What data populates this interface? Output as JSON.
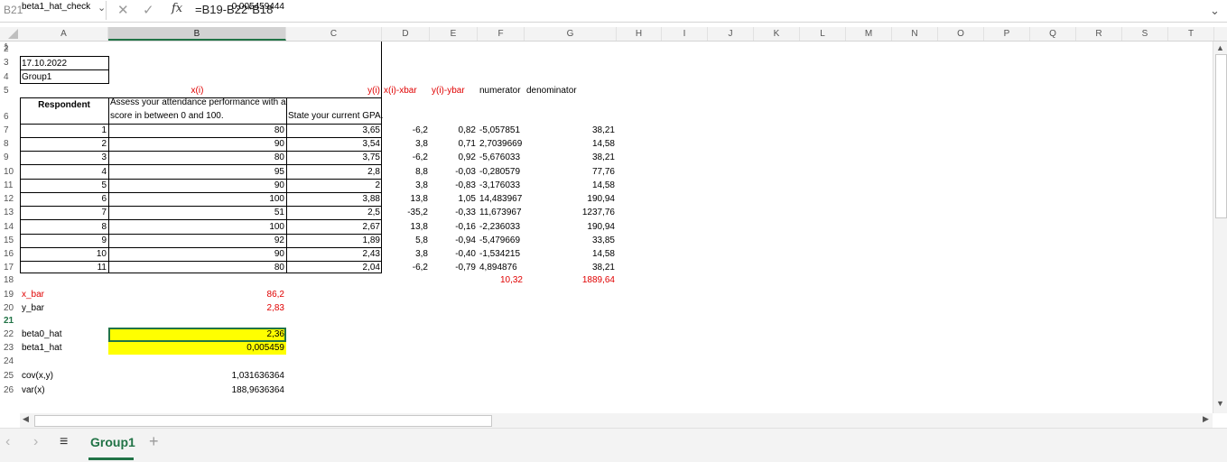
{
  "formula_bar": {
    "name_box": "B21",
    "fx_label": "fx",
    "formula": "=B19-B22*B18"
  },
  "columns": [
    "A",
    "B",
    "C",
    "D",
    "E",
    "F",
    "G",
    "H",
    "I",
    "J",
    "K",
    "L",
    "M",
    "N",
    "O",
    "P",
    "Q",
    "R",
    "S",
    "T"
  ],
  "row_numbers": [
    "1",
    "2",
    "3",
    "4",
    "5",
    "6",
    "7",
    "8",
    "9",
    "10",
    "11",
    "12",
    "13",
    "14",
    "15",
    "16",
    "17",
    "18",
    "19",
    "20",
    "21",
    "22",
    "23",
    "24",
    "25",
    "26"
  ],
  "sheet": {
    "date": "17.10.2022",
    "group": "Group1",
    "x_label": "x(i)",
    "y_label": "y(i)",
    "xdev_label": "x(i)-xbar",
    "ydev_label": "y(i)-ybar",
    "numerator_label": "numerator",
    "denominator_label": "denominator",
    "respondent_header": "Respondent",
    "b_header_line1": "Assess your attendance performance with a",
    "b_header_line2": "score in between 0 and 100.",
    "c_header": "State your current GPA.",
    "rows": [
      {
        "n": "1",
        "x": "80",
        "y": "3,65",
        "dx": "-6,2",
        "dy": "0,82",
        "num": "-5,057851",
        "den": "38,21"
      },
      {
        "n": "2",
        "x": "90",
        "y": "3,54",
        "dx": "3,8",
        "dy": "0,71",
        "num": "2,7039669",
        "den": "14,58"
      },
      {
        "n": "3",
        "x": "80",
        "y": "3,75",
        "dx": "-6,2",
        "dy": "0,92",
        "num": "-5,676033",
        "den": "38,21"
      },
      {
        "n": "4",
        "x": "95",
        "y": "2,8",
        "dx": "8,8",
        "dy": "-0,03",
        "num": "-0,280579",
        "den": "77,76"
      },
      {
        "n": "5",
        "x": "90",
        "y": "2",
        "dx": "3,8",
        "dy": "-0,83",
        "num": "-3,176033",
        "den": "14,58"
      },
      {
        "n": "6",
        "x": "100",
        "y": "3,88",
        "dx": "13,8",
        "dy": "1,05",
        "num": "14,483967",
        "den": "190,94"
      },
      {
        "n": "7",
        "x": "51",
        "y": "2,5",
        "dx": "-35,2",
        "dy": "-0,33",
        "num": "11,673967",
        "den": "1237,76"
      },
      {
        "n": "8",
        "x": "100",
        "y": "2,67",
        "dx": "13,8",
        "dy": "-0,16",
        "num": "-2,236033",
        "den": "190,94"
      },
      {
        "n": "9",
        "x": "92",
        "y": "1,89",
        "dx": "5,8",
        "dy": "-0,94",
        "num": "-5,479669",
        "den": "33,85"
      },
      {
        "n": "10",
        "x": "90",
        "y": "2,43",
        "dx": "3,8",
        "dy": "-0,40",
        "num": "-1,534215",
        "den": "14,58"
      },
      {
        "n": "11",
        "x": "80",
        "y": "2,04",
        "dx": "-6,2",
        "dy": "-0,79",
        "num": "4,894876",
        "den": "38,21"
      }
    ],
    "sum_num": "10,32",
    "sum_den": "1889,64",
    "x_bar_label": "x_bar",
    "x_bar_value": "86,2",
    "y_bar_label": "y_bar",
    "y_bar_value": "2,83",
    "beta0_label": "beta0_hat",
    "beta0_value": "2,36",
    "beta1_label": "beta1_hat",
    "beta1_value": "0,005459",
    "cov_label": "cov(x,y)",
    "cov_value": "1,031636364",
    "var_label": "var(x)",
    "var_value": "188,9636364",
    "beta1_check_label": "beta1_hat_check",
    "beta1_check_value": "0,005459444"
  },
  "tabs": {
    "sheet1": "Group1",
    "add": "+"
  },
  "colors": {
    "accent": "#217346",
    "highlight": "#ffff00",
    "red_text": "#e00000"
  }
}
